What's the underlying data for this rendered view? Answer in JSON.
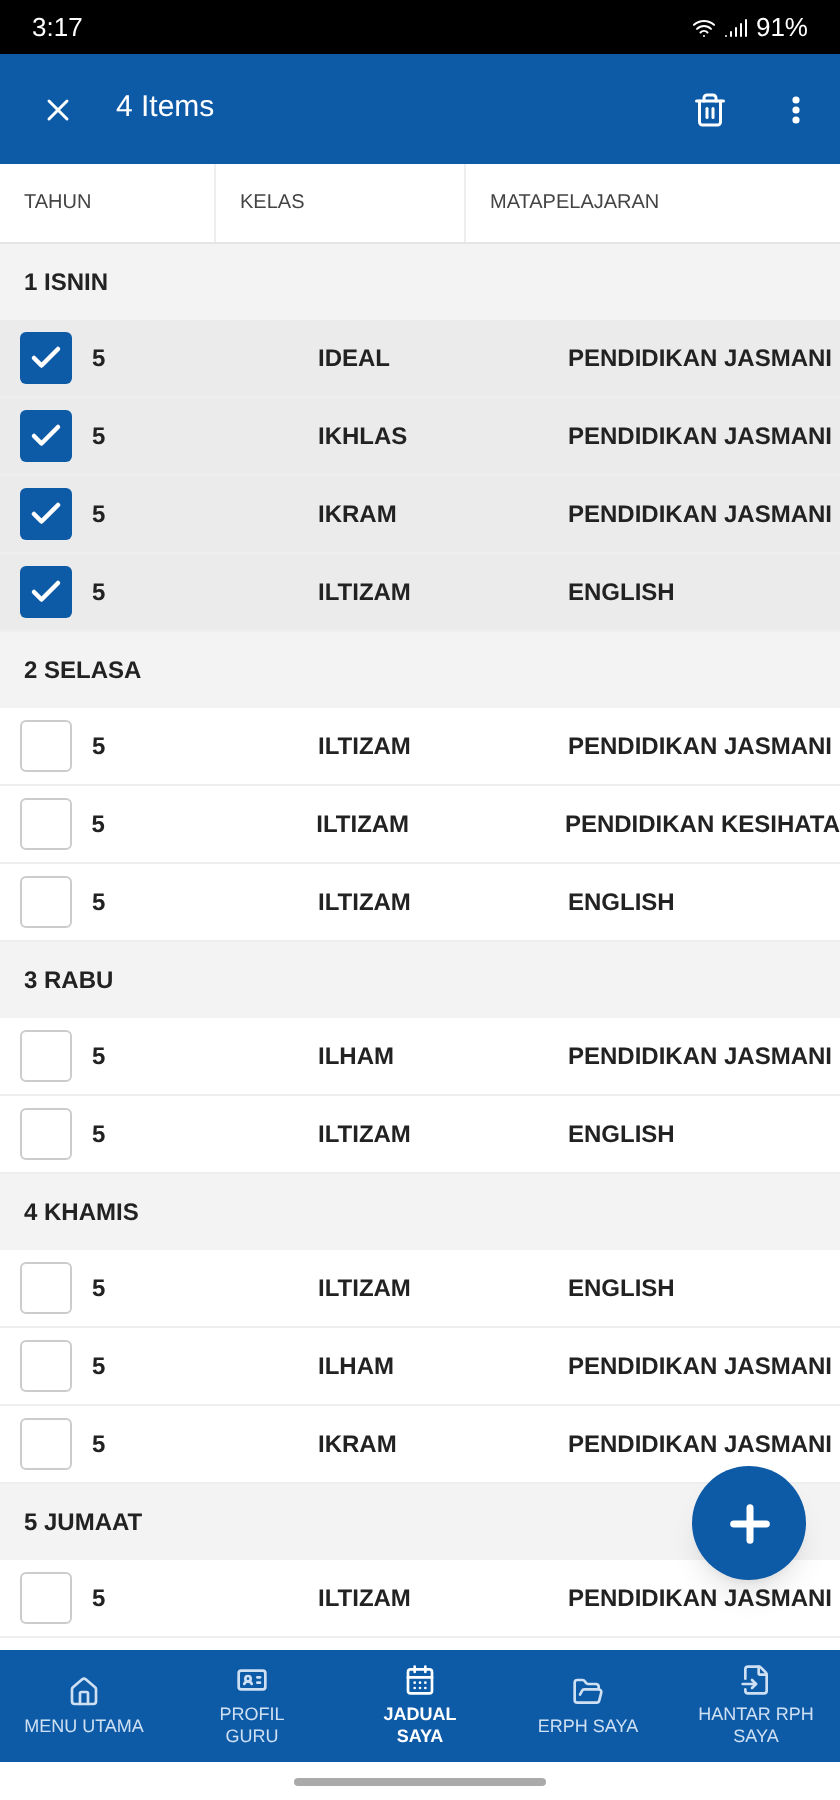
{
  "status_bar": {
    "time": "3:17",
    "battery": "91%"
  },
  "app_bar": {
    "title": "4 Items"
  },
  "columns": [
    "TAHUN",
    "KELAS",
    "MATAPELAJARAN"
  ],
  "groups": [
    {
      "title": "1 ISNIN",
      "rows": [
        {
          "tahun": "5",
          "kelas": "IDEAL",
          "subject": "PENDIDIKAN JASMANI",
          "selected": true
        },
        {
          "tahun": "5",
          "kelas": "IKHLAS",
          "subject": "PENDIDIKAN JASMANI",
          "selected": true
        },
        {
          "tahun": "5",
          "kelas": "IKRAM",
          "subject": "PENDIDIKAN JASMANI",
          "selected": true
        },
        {
          "tahun": "5",
          "kelas": "ILTIZAM",
          "subject": "ENGLISH",
          "selected": true
        }
      ]
    },
    {
      "title": "2 SELASA",
      "rows": [
        {
          "tahun": "5",
          "kelas": "ILTIZAM",
          "subject": "PENDIDIKAN JASMANI",
          "selected": false
        },
        {
          "tahun": "5",
          "kelas": "ILTIZAM",
          "subject": "PENDIDIKAN KESIHATA",
          "selected": false
        },
        {
          "tahun": "5",
          "kelas": "ILTIZAM",
          "subject": "ENGLISH",
          "selected": false
        }
      ]
    },
    {
      "title": "3 RABU",
      "rows": [
        {
          "tahun": "5",
          "kelas": "ILHAM",
          "subject": "PENDIDIKAN JASMANI",
          "selected": false
        },
        {
          "tahun": "5",
          "kelas": "ILTIZAM",
          "subject": "ENGLISH",
          "selected": false
        }
      ]
    },
    {
      "title": "4 KHAMIS",
      "rows": [
        {
          "tahun": "5",
          "kelas": "ILTIZAM",
          "subject": "ENGLISH",
          "selected": false
        },
        {
          "tahun": "5",
          "kelas": "ILHAM",
          "subject": "PENDIDIKAN JASMANI",
          "selected": false
        },
        {
          "tahun": "5",
          "kelas": "IKRAM",
          "subject": "PENDIDIKAN JASMANI",
          "selected": false
        }
      ]
    },
    {
      "title": "5 JUMAAT",
      "rows": [
        {
          "tahun": "5",
          "kelas": "ILTIZAM",
          "subject": "PENDIDIKAN JASMANI",
          "selected": false
        }
      ]
    }
  ],
  "nav": [
    {
      "label": "MENU UTAMA",
      "selected": false
    },
    {
      "label": "PROFIL GURU",
      "selected": false
    },
    {
      "label": "JADUAL SAYA",
      "selected": true
    },
    {
      "label": "ERPH SAYA",
      "selected": false
    },
    {
      "label": "HANTAR RPH SAYA",
      "selected": false
    }
  ]
}
